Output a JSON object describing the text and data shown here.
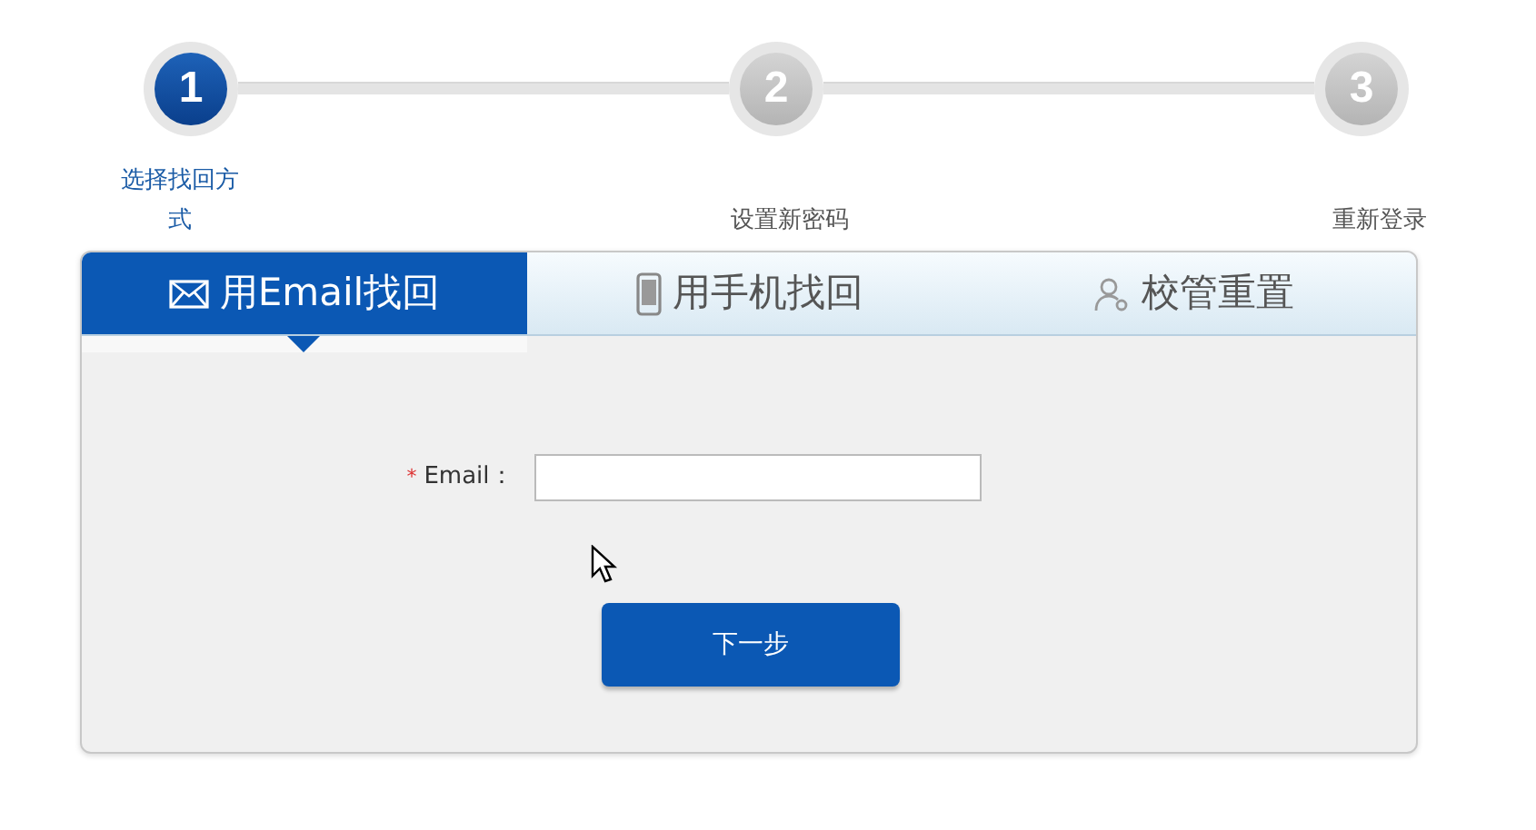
{
  "steps": [
    {
      "number": "1",
      "label": "选择找回方式",
      "selected": true
    },
    {
      "number": "2",
      "label": "设置新密码",
      "selected": false
    },
    {
      "number": "3",
      "label": "重新登录",
      "selected": false
    }
  ],
  "tabs": [
    {
      "label": "用Email找回",
      "selected": true
    },
    {
      "label": "用手机找回",
      "selected": false
    },
    {
      "label": "校管重置",
      "selected": false
    }
  ],
  "form": {
    "required_mark": "*",
    "label": "Email："
  },
  "buttons": [
    "下一步"
  ]
}
